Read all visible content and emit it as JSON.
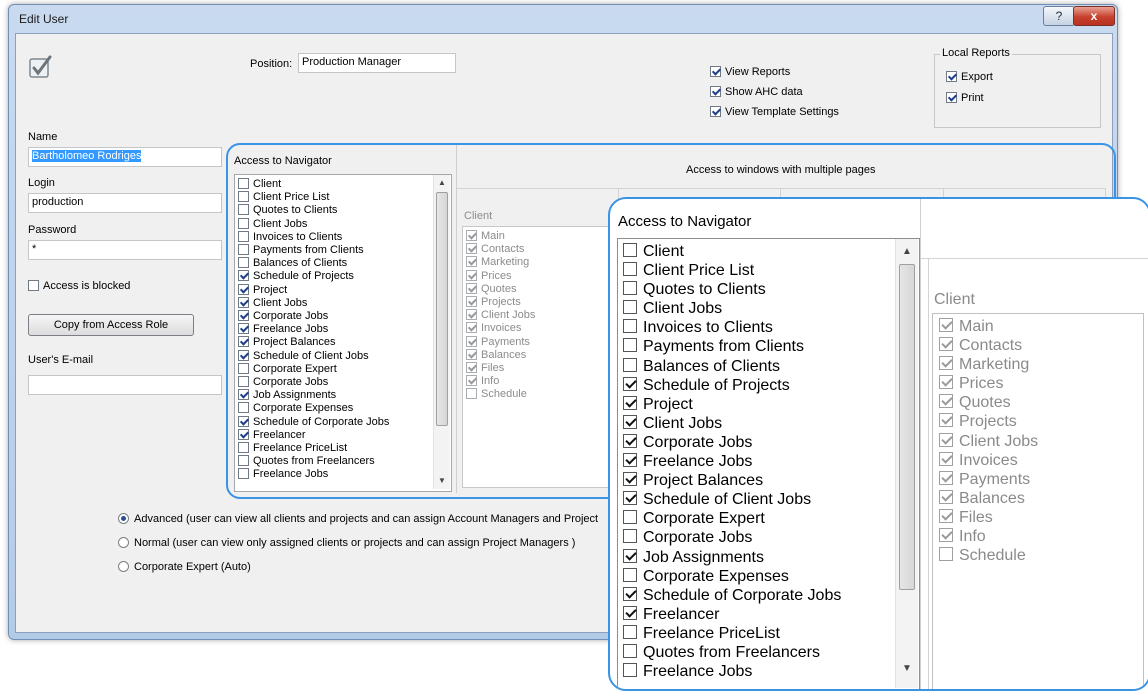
{
  "window": {
    "title": "Edit User",
    "help_glyph": "?",
    "close_glyph": "x"
  },
  "icons": {
    "app": "checkbox-edit-icon"
  },
  "position": {
    "label": "Position:",
    "value": "Production Manager"
  },
  "view_options": [
    {
      "label": "View Reports",
      "checked": true
    },
    {
      "label": "Show AHC data",
      "checked": true
    },
    {
      "label": "View Template Settings",
      "checked": true
    }
  ],
  "local_reports": {
    "title": "Local Reports",
    "items": [
      {
        "label": "Export",
        "checked": true
      },
      {
        "label": "Print",
        "checked": true
      }
    ]
  },
  "user": {
    "name_label": "Name",
    "name_value": "Bartholomeo Rodriges",
    "login_label": "Login",
    "login_value": "production",
    "password_label": "Password",
    "password_value": "*",
    "blocked_label": "Access is blocked",
    "copy_button": "Copy from Access Role",
    "email_label": "User's E-mail",
    "email_value": ""
  },
  "navigator": {
    "title": "Access to Navigator",
    "items": [
      {
        "label": "Client",
        "checked": false
      },
      {
        "label": "Client Price List",
        "checked": false
      },
      {
        "label": "Quotes to Clients",
        "checked": false
      },
      {
        "label": "Client Jobs",
        "checked": false
      },
      {
        "label": "Invoices to Clients",
        "checked": false
      },
      {
        "label": "Payments from Clients",
        "checked": false
      },
      {
        "label": "Balances of Clients",
        "checked": false
      },
      {
        "label": "Schedule of Projects",
        "checked": true
      },
      {
        "label": "Project",
        "checked": true
      },
      {
        "label": "Client Jobs",
        "checked": true
      },
      {
        "label": "Corporate Jobs",
        "checked": true
      },
      {
        "label": "Freelance Jobs",
        "checked": true
      },
      {
        "label": "Project Balances",
        "checked": true
      },
      {
        "label": "Schedule of Client Jobs",
        "checked": true
      },
      {
        "label": "Corporate Expert",
        "checked": false
      },
      {
        "label": "Corporate Jobs",
        "checked": false
      },
      {
        "label": "Job Assignments",
        "checked": true
      },
      {
        "label": "Corporate Expenses",
        "checked": false
      },
      {
        "label": "Schedule of Corporate Jobs",
        "checked": true
      },
      {
        "label": "Freelancer",
        "checked": true
      },
      {
        "label": "Freelance PriceList",
        "checked": false
      },
      {
        "label": "Quotes from Freelancers",
        "checked": false
      },
      {
        "label": "Freelance Jobs",
        "checked": false
      }
    ]
  },
  "pages": {
    "title": "Access to windows with multiple pages",
    "client_label": "Client",
    "items": [
      {
        "label": "Main",
        "checked": true
      },
      {
        "label": "Contacts",
        "checked": true
      },
      {
        "label": "Marketing",
        "checked": true
      },
      {
        "label": "Prices",
        "checked": true
      },
      {
        "label": "Quotes",
        "checked": true
      },
      {
        "label": "Projects",
        "checked": true
      },
      {
        "label": "Client Jobs",
        "checked": true
      },
      {
        "label": "Invoices",
        "checked": true
      },
      {
        "label": "Payments",
        "checked": true
      },
      {
        "label": "Balances",
        "checked": true
      },
      {
        "label": "Files",
        "checked": true
      },
      {
        "label": "Info",
        "checked": true
      },
      {
        "label": "Schedule",
        "checked": false
      }
    ]
  },
  "modes": [
    {
      "label": "Advanced (user can view all clients and projects and can assign Account Managers and Project",
      "selected": true
    },
    {
      "label": "Normal (user can view only assigned clients or projects and can assign Project Managers )",
      "selected": false
    },
    {
      "label": "Corporate Expert (Auto)",
      "selected": false
    }
  ],
  "colors": {
    "accent": "#3b93e8",
    "selection": "#3399ff"
  }
}
